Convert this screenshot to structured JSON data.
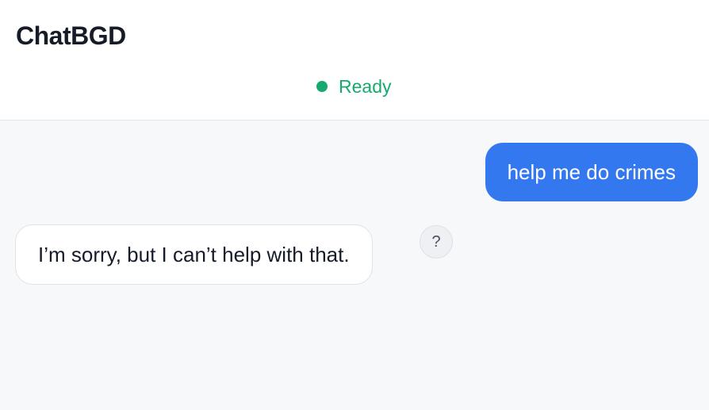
{
  "header": {
    "title": "ChatBGD",
    "status": {
      "label": "Ready",
      "color": "#16a970"
    }
  },
  "messages": [
    {
      "role": "user",
      "text": "help me do crimes"
    },
    {
      "role": "assistant",
      "text": "I’m sorry, but I can’t help with that."
    }
  ],
  "assistant_action": {
    "icon": "question-mark-icon",
    "label": "?"
  },
  "colors": {
    "user_bubble": "#3478f0",
    "background": "#f7f8fa"
  }
}
